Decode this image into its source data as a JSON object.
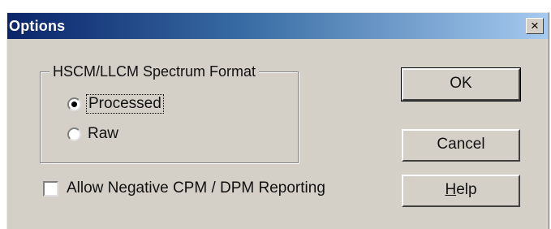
{
  "window": {
    "title": "Options",
    "close_label": "×"
  },
  "group": {
    "label": "HSCM/LLCM Spectrum Format",
    "options": [
      {
        "label": "Processed",
        "selected": true
      },
      {
        "label": "Raw",
        "selected": false
      }
    ]
  },
  "checkbox": {
    "label": "Allow Negative CPM / DPM Reporting",
    "checked": false
  },
  "buttons": {
    "ok": "OK",
    "cancel": "Cancel",
    "help": "Help"
  },
  "colors": {
    "face": "#d4d0c8",
    "title_start": "#0a246a",
    "title_end": "#a6caf0"
  }
}
